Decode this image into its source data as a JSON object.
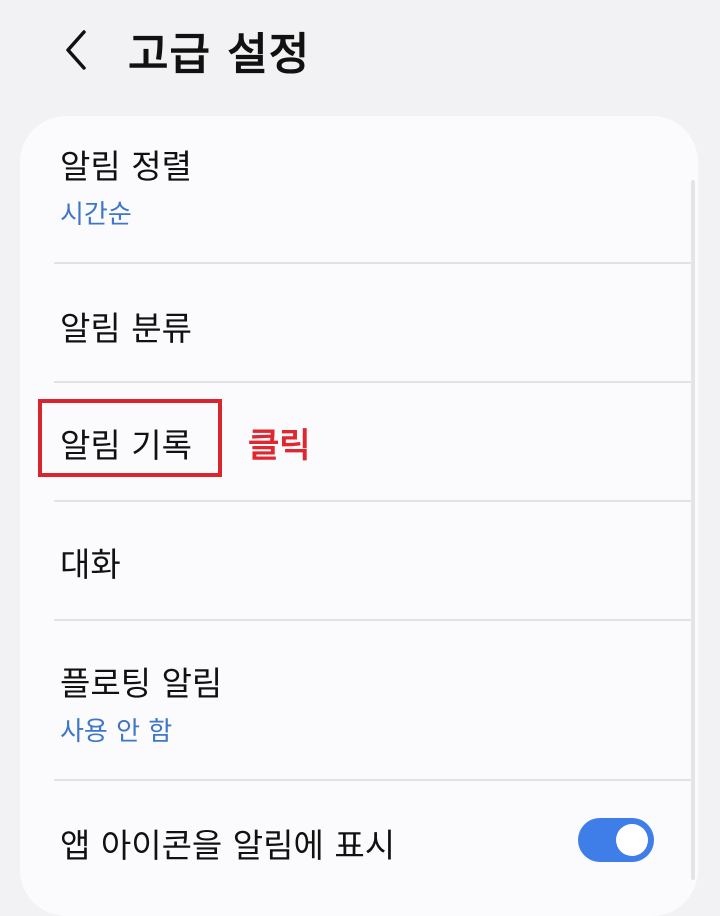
{
  "header": {
    "back_icon": "chevron-left-icon",
    "title": "고급 설정"
  },
  "settings": {
    "items": [
      {
        "title": "알림 정렬",
        "subtitle": "시간순"
      },
      {
        "title": "알림 분류"
      },
      {
        "title": "알림 기록"
      },
      {
        "title": "대화"
      },
      {
        "title": "플로팅 알림",
        "subtitle": "사용 안 함"
      },
      {
        "title": "앱 아이콘을 알림에 표시",
        "toggle_on": true
      }
    ]
  },
  "annotation": {
    "label": "클릭",
    "color": "#e0262f",
    "box_color": "#d8262e"
  },
  "colors": {
    "accent": "#3e76c8",
    "toggle_on": "#3f7de8",
    "background": "#f2f2f4",
    "card": "#fbfbfd"
  }
}
